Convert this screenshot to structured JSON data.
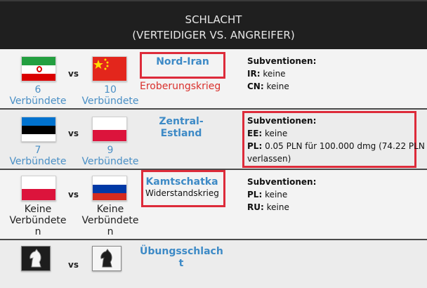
{
  "header": {
    "line1": "SCHLACHT",
    "line2": "(VERTEIDIGER VS. ANGREIFER)"
  },
  "vs_label": "vs",
  "battles": [
    {
      "defender": {
        "flag": "iran-flag",
        "allies_count": "6",
        "allies_word": "Verbündete"
      },
      "attacker": {
        "flag": "china-flag",
        "allies_count": "10",
        "allies_word": "Verbündete"
      },
      "region": "Nord-Iran",
      "war_type": "Eroberungskrieg",
      "subsidies": {
        "title": "Subventionen:",
        "lines": [
          {
            "code": "IR:",
            "text": " keine"
          },
          {
            "code": "CN:",
            "text": " keine"
          }
        ]
      }
    },
    {
      "defender": {
        "flag": "estonia-flag",
        "allies_count": "7",
        "allies_word": "Verbündete"
      },
      "attacker": {
        "flag": "poland-flag",
        "allies_count": "9",
        "allies_word": "Verbündete"
      },
      "region": "Zentral-Estland",
      "subsidies": {
        "title": "Subventionen:",
        "lines": [
          {
            "code": "EE:",
            "text": " keine"
          },
          {
            "code": "PL:",
            "text": " 0.05 PLN für 100.000 dmg (74.22 PLN"
          },
          {
            "code": "",
            "text": "verlassen)"
          }
        ]
      }
    },
    {
      "defender": {
        "flag": "poland-flag",
        "allies_l1": "Keine",
        "allies_l2": "Verbündete",
        "allies_l3": "n"
      },
      "attacker": {
        "flag": "russia-flag",
        "allies_l1": "Keine",
        "allies_l2": "Verbündete",
        "allies_l3": "n"
      },
      "region": "Kamtschatka",
      "war_type": "Widerstandskrieg",
      "subsidies": {
        "title": "Subventionen:",
        "lines": [
          {
            "code": "PL:",
            "text": " keine"
          },
          {
            "code": "RU:",
            "text": " keine"
          }
        ]
      }
    },
    {
      "defender": {
        "flag": "chess-knight-white-icon"
      },
      "attacker": {
        "flag": "chess-knight-black-icon"
      },
      "region_l1": "Übungsschlach",
      "region_l2": "t"
    }
  ],
  "colors": {
    "header_bg": "#1f1f1f",
    "link_blue": "#3d8ac6",
    "allies_blue": "#4a8fc5",
    "highlight_red": "#dd2b3a",
    "conquest_red": "#d9302c"
  }
}
